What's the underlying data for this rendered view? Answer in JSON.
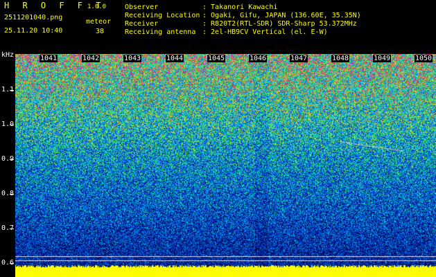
{
  "app": {
    "logo": "H R O F F T",
    "version": "1.0.0",
    "filename": "2511201040.png",
    "datetime": "25.11.20 10:40",
    "mode_label": "meteor",
    "meteor_count": "38"
  },
  "info": {
    "labels": [
      "Observer",
      "Receiving Location",
      "Receiver",
      "Receiving antenna"
    ],
    "values": [
      ": Takanori Kawachi",
      ": Ogaki, Gifu, JAPAN (136.60E, 35.35N)",
      ": R820T2(RTL-SDR) SDR-Sharp 53.372MHz",
      ": 2el-HB9CV Vertical (el. E-W)"
    ]
  },
  "axes": {
    "unit": "kHz",
    "minutes": [
      "1041",
      "1042",
      "1043",
      "1044",
      "1045",
      "1046",
      "1047",
      "1048",
      "1049",
      "1050"
    ],
    "freq_ticks": [
      "1.1",
      "1.0",
      "0.9",
      "0.8",
      "0.7",
      "0.6"
    ]
  },
  "colors": {
    "header_text": "#ffff00",
    "label_text": "#ffffff"
  }
}
